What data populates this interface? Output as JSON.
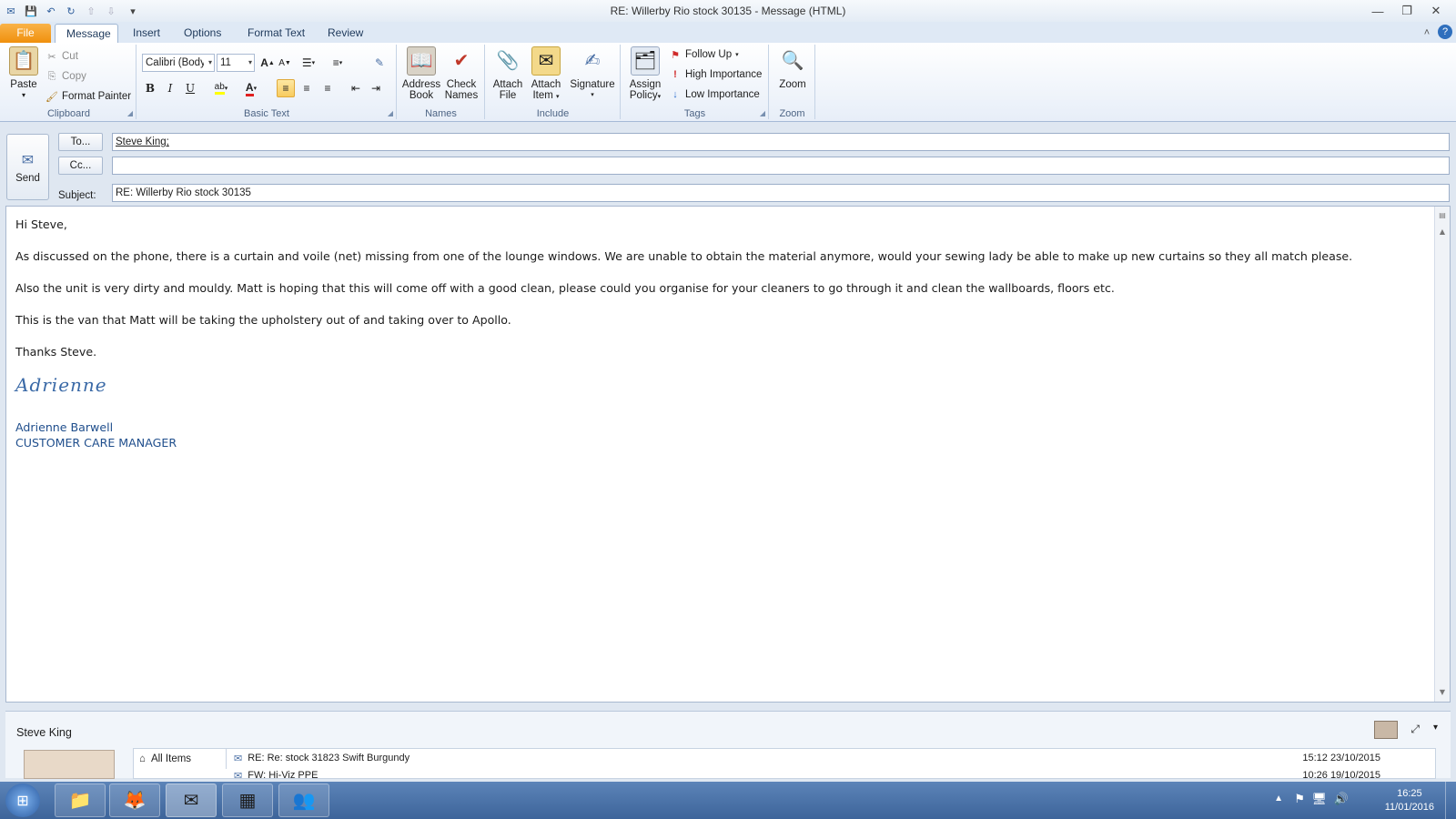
{
  "window": {
    "title": "RE: Willerby Rio stock 30135  -  Message (HTML)"
  },
  "tabs": [
    "File",
    "Message",
    "Insert",
    "Options",
    "Format Text",
    "Review"
  ],
  "ribbon": {
    "clipboard": {
      "label": "Clipboard",
      "paste": "Paste",
      "cut": "Cut",
      "copy": "Copy",
      "format_painter": "Format Painter"
    },
    "basic_text": {
      "label": "Basic Text",
      "font_name": "Calibri (Body)",
      "font_size": "11"
    },
    "names": {
      "label": "Names",
      "address_book_1": "Address",
      "address_book_2": "Book",
      "check_names_1": "Check",
      "check_names_2": "Names"
    },
    "include": {
      "label": "Include",
      "attach_file_1": "Attach",
      "attach_file_2": "File",
      "attach_item_1": "Attach",
      "attach_item_2": "Item",
      "signature": "Signature"
    },
    "tags": {
      "label": "Tags",
      "assign_policy_1": "Assign",
      "assign_policy_2": "Policy",
      "follow_up": "Follow Up",
      "high_importance": "High Importance",
      "low_importance": "Low Importance"
    },
    "zoom": {
      "label": "Zoom",
      "zoom": "Zoom"
    }
  },
  "header": {
    "send": "Send",
    "to_button": "To...",
    "cc_button": "Cc...",
    "subject_label": "Subject:",
    "to_value": "Steve King;",
    "cc_value": "",
    "subject_value": "RE: Willerby Rio stock 30135"
  },
  "body": {
    "greeting": "Hi Steve,",
    "p1": "As discussed on the phone, there is a curtain and voile (net) missing from one of the lounge windows.  We are unable to obtain the material anymore, would your sewing lady be able to make up new curtains so they all match please.",
    "p2": "Also the unit is very dirty and mouldy.  Matt is hoping that this will come off with a good clean, please could you organise for your cleaners to go through it and clean the wallboards, floors etc.",
    "p3": "This is the van that Matt will be taking the upholstery out of and taking over to Apollo.",
    "p4": "Thanks Steve.",
    "signature_script": "Adrienne",
    "sig_name": "Adrienne Barwell",
    "sig_title": "CUSTOMER CARE MANAGER"
  },
  "people_pane": {
    "name": "Steve King",
    "filter": "All Items",
    "items": [
      {
        "subject": "RE: Re: stock 31823 Swift Burgundy",
        "when": "15:12  23/10/2015"
      },
      {
        "subject": "FW: Hi-Viz PPE",
        "when": "10:26  19/10/2015"
      }
    ]
  },
  "taskbar": {
    "time": "16:25",
    "date": "11/01/2016"
  }
}
